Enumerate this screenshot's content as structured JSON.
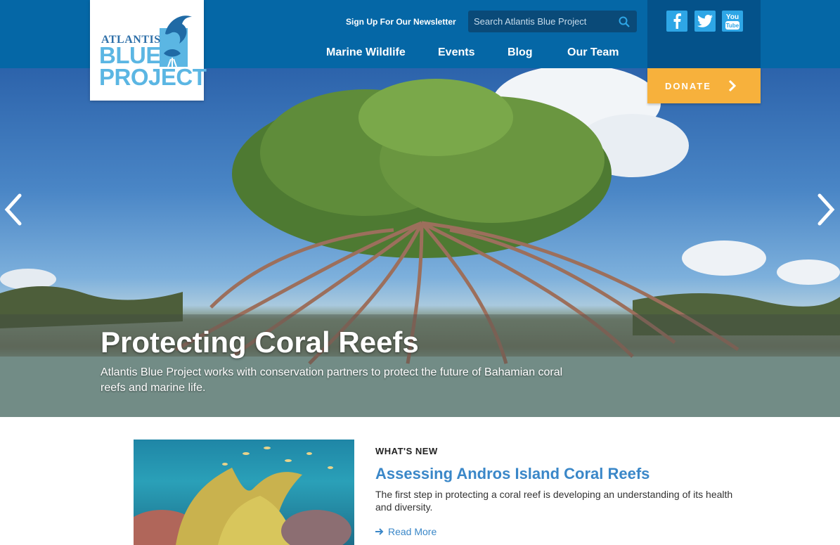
{
  "logo": {
    "line1": "ATLANTIS",
    "line2": "BLUE",
    "line3": "PROJECT"
  },
  "header": {
    "newsletter_label": "Sign Up For Our Newsletter",
    "search_placeholder": "Search Atlantis Blue Project",
    "nav": [
      "Marine Wildlife",
      "Events",
      "Blog",
      "Our Team"
    ],
    "donate_label": "DONATE",
    "social": [
      "facebook-icon",
      "twitter-icon",
      "youtube-icon"
    ]
  },
  "hero": {
    "title": "Protecting Coral Reefs",
    "subtitle": "Atlantis Blue Project works with conservation partners to protect the future of Bahamian coral reefs and marine life."
  },
  "news": {
    "kicker": "WHAT'S NEW",
    "title": "Assessing Andros Island Coral Reefs",
    "text": "The first step in protecting a coral reef is developing an understanding of its health and diversity.",
    "read_more": "Read More"
  },
  "colors": {
    "header_bg": "#0567a6",
    "donate": "#f7b13c",
    "link": "#3a87c8"
  }
}
